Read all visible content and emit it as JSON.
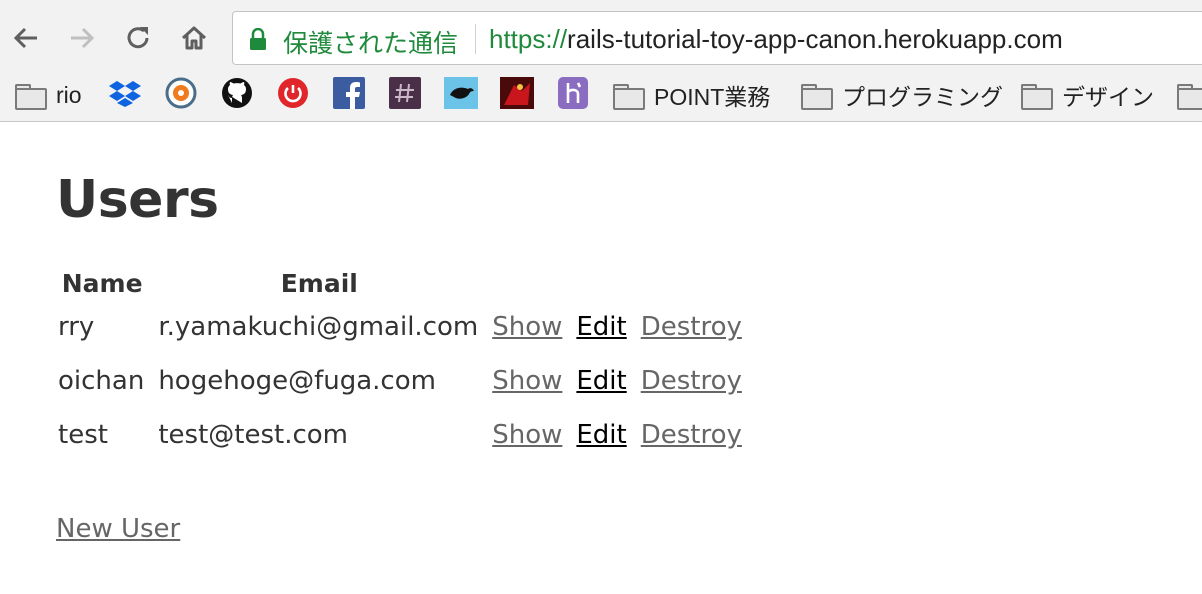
{
  "browser": {
    "secure_label": "保護された通信",
    "url_scheme": "https://",
    "url_rest": "rails-tutorial-toy-app-canon.herokuapp.com"
  },
  "bookmarks": {
    "rio": "rio",
    "point": "POINT業務",
    "programming": "プログラミング",
    "design": "デザイン"
  },
  "page": {
    "title": "Users",
    "headers": [
      "Name",
      "Email"
    ],
    "users": [
      {
        "name": "rry",
        "email": "r.yamakuchi@gmail.com"
      },
      {
        "name": "oichan",
        "email": "hogehoge@fuga.com"
      },
      {
        "name": "test",
        "email": "test@test.com"
      }
    ],
    "actions": {
      "show": "Show",
      "edit": "Edit",
      "destroy": "Destroy"
    },
    "new_user": "New User"
  },
  "colors": {
    "secure_green": "#1f8a3c",
    "link_gray": "#666666",
    "heading": "#333333"
  }
}
